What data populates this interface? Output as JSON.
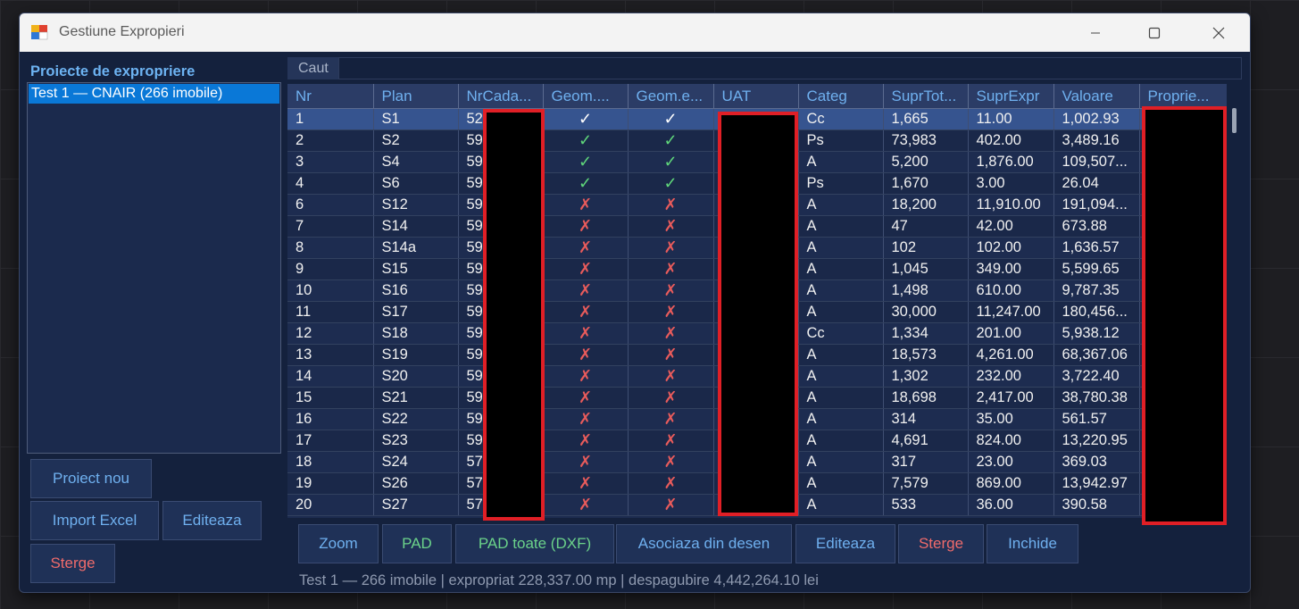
{
  "window": {
    "title": "Gestiune Expropieri"
  },
  "left": {
    "heading": "Proiecte de expropriere",
    "projects": [
      "Test 1 — CNAIR (266 imobile)"
    ],
    "buttons": {
      "new": "Proiect nou",
      "import": "Import Excel",
      "edit": "Editeaza",
      "delete": "Sterge"
    }
  },
  "search": {
    "label": "Caut",
    "value": ""
  },
  "table": {
    "columns": [
      "Nr",
      "Plan",
      "NrCada...",
      "Geom....",
      "Geom.e...",
      "UAT",
      "Categ",
      "SuprTot...",
      "SuprExpr",
      "Valoare",
      "Proprie..."
    ],
    "rows": [
      {
        "nr": "1",
        "plan": "S1",
        "cad": "52",
        "g1": "✓",
        "g2": "✓",
        "uat": "",
        "categ": "Cc",
        "tot": "1,665",
        "expr": "11.00",
        "val": "1,002.93",
        "prop": ""
      },
      {
        "nr": "2",
        "plan": "S2",
        "cad": "59",
        "g1": "✓",
        "g2": "✓",
        "uat": "",
        "categ": "Ps",
        "tot": "73,983",
        "expr": "402.00",
        "val": "3,489.16",
        "prop": ""
      },
      {
        "nr": "3",
        "plan": "S4",
        "cad": "59",
        "g1": "✓",
        "g2": "✓",
        "uat": "",
        "categ": "A",
        "tot": "5,200",
        "expr": "1,876.00",
        "val": "109,507...",
        "prop": ""
      },
      {
        "nr": "4",
        "plan": "S6",
        "cad": "59",
        "g1": "✓",
        "g2": "✓",
        "uat": "",
        "categ": "Ps",
        "tot": "1,670",
        "expr": "3.00",
        "val": "26.04",
        "prop": ""
      },
      {
        "nr": "6",
        "plan": "S12",
        "cad": "59",
        "g1": "✗",
        "g2": "✗",
        "uat": "",
        "categ": "A",
        "tot": "18,200",
        "expr": "11,910.00",
        "val": "191,094...",
        "prop": ""
      },
      {
        "nr": "7",
        "plan": "S14",
        "cad": "59",
        "g1": "✗",
        "g2": "✗",
        "uat": "",
        "categ": "A",
        "tot": "47",
        "expr": "42.00",
        "val": "673.88",
        "prop": ""
      },
      {
        "nr": "8",
        "plan": "S14a",
        "cad": "59",
        "g1": "✗",
        "g2": "✗",
        "uat": "",
        "categ": "A",
        "tot": "102",
        "expr": "102.00",
        "val": "1,636.57",
        "prop": ""
      },
      {
        "nr": "9",
        "plan": "S15",
        "cad": "59",
        "g1": "✗",
        "g2": "✗",
        "uat": "",
        "categ": "A",
        "tot": "1,045",
        "expr": "349.00",
        "val": "5,599.65",
        "prop": ""
      },
      {
        "nr": "10",
        "plan": "S16",
        "cad": "59",
        "g1": "✗",
        "g2": "✗",
        "uat": "",
        "categ": "A",
        "tot": "1,498",
        "expr": "610.00",
        "val": "9,787.35",
        "prop": ""
      },
      {
        "nr": "11",
        "plan": "S17",
        "cad": "59",
        "g1": "✗",
        "g2": "✗",
        "uat": "",
        "categ": "A",
        "tot": "30,000",
        "expr": "11,247.00",
        "val": "180,456...",
        "prop": ""
      },
      {
        "nr": "12",
        "plan": "S18",
        "cad": "59",
        "g1": "✗",
        "g2": "✗",
        "uat": "",
        "categ": "Cc",
        "tot": "1,334",
        "expr": "201.00",
        "val": "5,938.12",
        "prop": ""
      },
      {
        "nr": "13",
        "plan": "S19",
        "cad": "59",
        "g1": "✗",
        "g2": "✗",
        "uat": "",
        "categ": "A",
        "tot": "18,573",
        "expr": "4,261.00",
        "val": "68,367.06",
        "prop": ""
      },
      {
        "nr": "14",
        "plan": "S20",
        "cad": "59",
        "g1": "✗",
        "g2": "✗",
        "uat": "",
        "categ": "A",
        "tot": "1,302",
        "expr": "232.00",
        "val": "3,722.40",
        "prop": ""
      },
      {
        "nr": "15",
        "plan": "S21",
        "cad": "59",
        "g1": "✗",
        "g2": "✗",
        "uat": "",
        "categ": "A",
        "tot": "18,698",
        "expr": "2,417.00",
        "val": "38,780.38",
        "prop": ""
      },
      {
        "nr": "16",
        "plan": "S22",
        "cad": "59",
        "g1": "✗",
        "g2": "✗",
        "uat": "",
        "categ": "A",
        "tot": "314",
        "expr": "35.00",
        "val": "561.57",
        "prop": ""
      },
      {
        "nr": "17",
        "plan": "S23",
        "cad": "59",
        "g1": "✗",
        "g2": "✗",
        "uat": "",
        "categ": "A",
        "tot": "4,691",
        "expr": "824.00",
        "val": "13,220.95",
        "prop": ""
      },
      {
        "nr": "18",
        "plan": "S24",
        "cad": "57",
        "g1": "✗",
        "g2": "✗",
        "uat": "",
        "categ": "A",
        "tot": "317",
        "expr": "23.00",
        "val": "369.03",
        "prop": ""
      },
      {
        "nr": "19",
        "plan": "S26",
        "cad": "57",
        "g1": "✗",
        "g2": "✗",
        "uat": "",
        "categ": "A",
        "tot": "7,579",
        "expr": "869.00",
        "val": "13,942.97",
        "prop": ""
      },
      {
        "nr": "20",
        "plan": "S27",
        "cad": "57",
        "g1": "✗",
        "g2": "✗",
        "uat": "",
        "categ": "A",
        "tot": "533",
        "expr": "36.00",
        "val": "390.58",
        "prop": ""
      }
    ]
  },
  "actions": {
    "zoom": "Zoom",
    "pad": "PAD",
    "pad_all": "PAD toate (DXF)",
    "assoc": "Asociaza din desen",
    "edit": "Editeaza",
    "delete": "Sterge",
    "close": "Inchide"
  },
  "status": "Test 1 — 266 imobile | expropriat 228,337.00 mp | despagubire 4,442,264.10 lei",
  "colors": {
    "accent": "#6fb0ef",
    "danger": "#e85b5b",
    "success": "#5fd67a",
    "selection": "#0a78d7",
    "redaction_border": "#e01f26"
  }
}
